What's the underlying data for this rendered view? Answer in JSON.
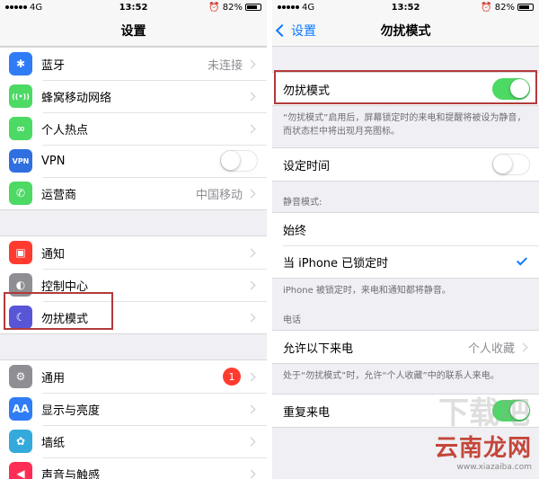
{
  "left": {
    "status": {
      "carrier": "4G",
      "time": "13:52",
      "battery": "82%",
      "battery_level": 0.82
    },
    "title": "设置",
    "group1": [
      {
        "name": "bluetooth",
        "icon": "bluetooth-icon",
        "glyph": "✱",
        "color": "#2f7cf6",
        "label": "蓝牙",
        "value": "未连接"
      },
      {
        "name": "cellular",
        "icon": "antenna-icon",
        "glyph": "((•))",
        "color": "#4cd964",
        "label": "蜂窝移动网络",
        "value": ""
      },
      {
        "name": "hotspot",
        "icon": "link-icon",
        "glyph": "∞",
        "color": "#4cd964",
        "label": "个人热点",
        "value": ""
      },
      {
        "name": "vpn",
        "icon": "vpn-icon",
        "glyph": "VPN",
        "color": "#2f6fe0",
        "label": "VPN",
        "toggle": false
      },
      {
        "name": "carrier",
        "icon": "phone-icon",
        "glyph": "✆",
        "color": "#4cd964",
        "label": "运营商",
        "value": "中国移动"
      }
    ],
    "group2": [
      {
        "name": "notifications",
        "icon": "notification-icon",
        "glyph": "▣",
        "color": "#ff3b30",
        "label": "通知"
      },
      {
        "name": "control-center",
        "icon": "control-center-icon",
        "glyph": "◐",
        "color": "#8e8e93",
        "label": "控制中心"
      },
      {
        "name": "do-not-disturb",
        "icon": "moon-icon",
        "glyph": "☾",
        "color": "#5856d6",
        "label": "勿扰模式"
      }
    ],
    "group3": [
      {
        "name": "general",
        "icon": "gear-icon",
        "glyph": "⚙",
        "color": "#8e8e93",
        "label": "通用",
        "badge": "1"
      },
      {
        "name": "display",
        "icon": "text-size-icon",
        "glyph": "AA",
        "color": "#2f7cf6",
        "label": "显示与亮度"
      },
      {
        "name": "wallpaper",
        "icon": "flower-icon",
        "glyph": "✿",
        "color": "#34aadc",
        "label": "墙纸"
      },
      {
        "name": "sounds",
        "icon": "speaker-icon",
        "glyph": "◀",
        "color": "#ff2d55",
        "label": "声音与触感"
      }
    ]
  },
  "right": {
    "status": {
      "carrier": "4G",
      "time": "13:52",
      "battery": "82%",
      "battery_level": 0.82
    },
    "back_label": "设置",
    "title": "勿扰模式",
    "dnd": {
      "label": "勿扰模式",
      "toggle": true
    },
    "dnd_note": "“勿扰模式”启用后，屏幕锁定时的来电和提醒将被设为静音，而状态栏中将出现月亮图标。",
    "scheduled": {
      "label": "设定时间",
      "toggle": false
    },
    "silence_header": "静音模式:",
    "silence_options": [
      {
        "label": "始终",
        "checked": false
      },
      {
        "label": "当 iPhone 已锁定时",
        "checked": true
      }
    ],
    "silence_note": "iPhone 被锁定时，来电和通知都将静音。",
    "phone_header": "电话",
    "allow_calls": {
      "label": "允许以下来电",
      "value": "个人收藏"
    },
    "allow_note": "处于“勿扰模式”时，允许“个人收藏”中的联系人来电。",
    "repeated": {
      "label": "重复来电",
      "toggle": true
    }
  },
  "watermark": {
    "main": "云南龙网",
    "faint": "下载吧",
    "url": "www.xiazaiba.com"
  },
  "colors": {
    "accent": "#0a7aff",
    "toggle_on": "#4cd964",
    "highlight": "#b33a3a"
  }
}
